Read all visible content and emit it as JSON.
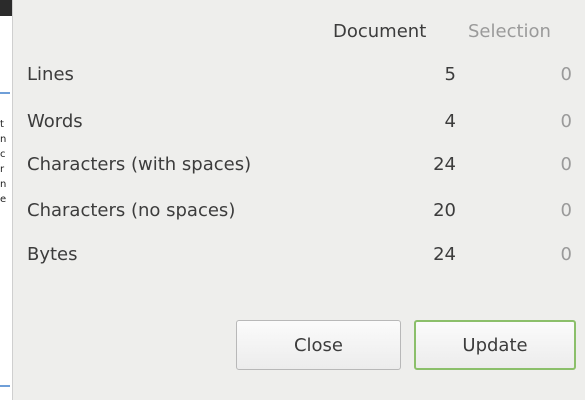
{
  "columns": {
    "document": "Document",
    "selection": "Selection"
  },
  "rows": [
    {
      "label": "Lines",
      "document": "5",
      "selection": "0"
    },
    {
      "label": "Words",
      "document": "4",
      "selection": "0"
    },
    {
      "label": "Characters (with spaces)",
      "document": "24",
      "selection": "0"
    },
    {
      "label": "Characters (no spaces)",
      "document": "20",
      "selection": "0"
    },
    {
      "label": "Bytes",
      "document": "24",
      "selection": "0"
    }
  ],
  "buttons": {
    "close": "Close",
    "update": "Update"
  },
  "background_fragments": [
    "t",
    "n",
    "c",
    "r",
    "n",
    "e"
  ],
  "colors": {
    "dialog_bg": "#eeeeec",
    "update_border": "#8bbf6a",
    "muted_text": "#9a9a9a"
  }
}
